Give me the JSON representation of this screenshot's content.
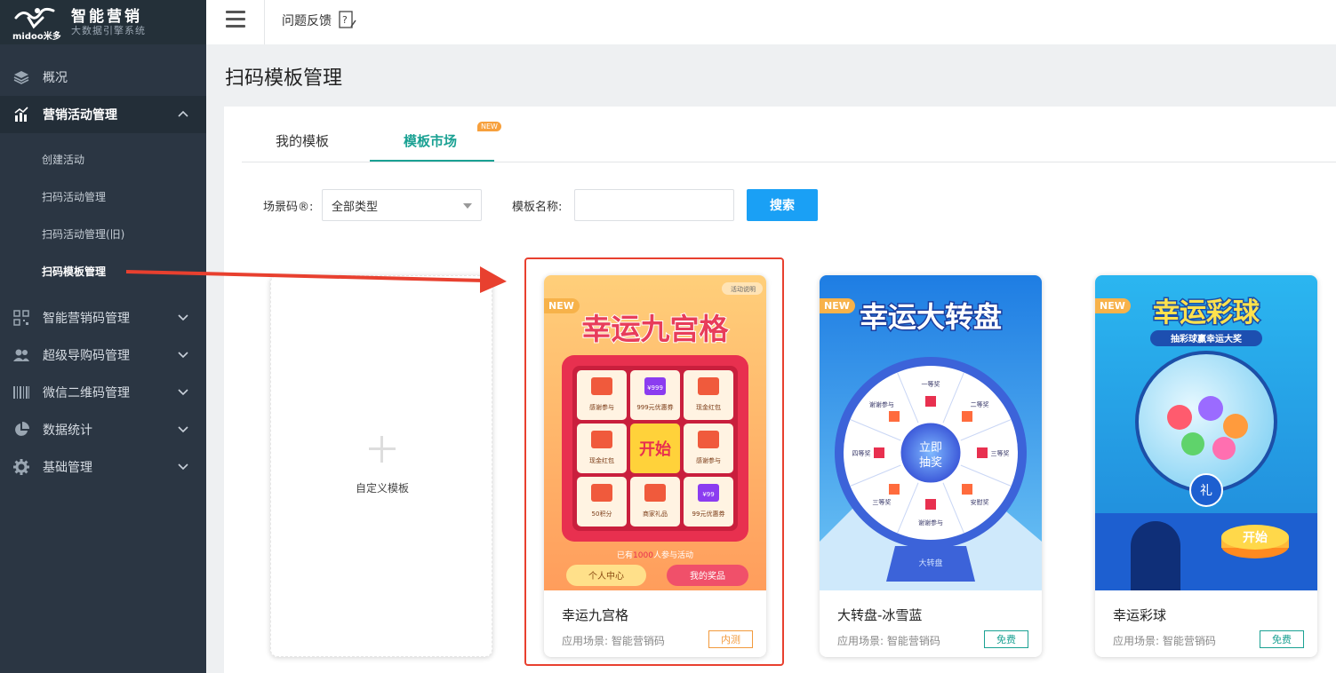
{
  "brand": {
    "title": "智能营销",
    "subtitle": "大数据引擎系统",
    "logo_text": "midoo米多"
  },
  "sidebar": {
    "items": [
      {
        "label": "概况",
        "icon": "layers-icon"
      },
      {
        "label": "营销活动管理",
        "icon": "chart-icon"
      },
      {
        "label": "智能营销码管理",
        "icon": "qrcode-icon"
      },
      {
        "label": "超级导购码管理",
        "icon": "users-icon"
      },
      {
        "label": "微信二维码管理",
        "icon": "barcode-icon"
      },
      {
        "label": "数据统计",
        "icon": "pie-icon"
      },
      {
        "label": "基础管理",
        "icon": "gear-icon"
      }
    ],
    "sub_items": [
      {
        "label": "创建活动"
      },
      {
        "label": "扫码活动管理"
      },
      {
        "label": "扫码活动管理(旧)"
      },
      {
        "label": "扫码模板管理"
      }
    ]
  },
  "topbar": {
    "feedback_label": "问题反馈"
  },
  "page": {
    "title": "扫码模板管理"
  },
  "tabs": [
    {
      "label": "我的模板"
    },
    {
      "label": "模板市场",
      "badge": "NEW"
    }
  ],
  "filters": {
    "scene_label": "场景码®:",
    "scene_value": "全部类型",
    "name_label": "模板名称:",
    "name_placeholder": "",
    "search_label": "搜索"
  },
  "custom_template": {
    "label": "自定义模板"
  },
  "cards": [
    {
      "name": "幸运九宫格",
      "scene": "应用场景:  智能营销码",
      "tag": "内测",
      "ribbon": "NEW",
      "banner": "幸运九宫格",
      "info": "活动说明",
      "grid": [
        "感谢参与",
        "999元优惠券",
        "现金红包",
        "现金红包",
        "开始",
        "感谢参与",
        "50积分",
        "商家礼品",
        "99元优惠券"
      ],
      "grid_badges": [
        "",
        "¥999",
        "",
        "",
        "",
        "",
        "",
        "",
        "¥99"
      ],
      "participants_prefix": "已有",
      "participants_count": "1000",
      "participants_suffix": "人参与活动",
      "btn_left": "个人中心",
      "btn_right": "我的奖品"
    },
    {
      "name": "大转盘-冰雪蓝",
      "scene": "应用场景:  智能营销码",
      "tag": "免费",
      "ribbon": "NEW",
      "banner": "幸运大转盘",
      "wheel_center_line1": "立即",
      "wheel_center_line2": "抽奖",
      "wheel_labels": [
        "一等奖",
        "二等奖",
        "三等奖",
        "安慰奖",
        "谢谢参与",
        "三等奖",
        "四等奖",
        "谢谢参与"
      ],
      "base_label": "大转盘"
    },
    {
      "name": "幸运彩球",
      "scene": "应用场景:  智能营销码",
      "tag": "免费",
      "ribbon": "NEW",
      "banner": "幸运彩球",
      "banner_sub": "抽彩球赢幸运大奖",
      "ball_label": "礼",
      "start_label": "开始"
    }
  ]
}
